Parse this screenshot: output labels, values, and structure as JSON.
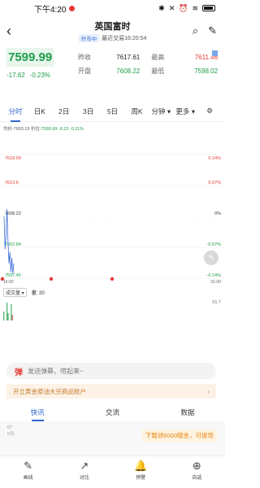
{
  "status": {
    "time": "下午4:20"
  },
  "header": {
    "title": "英国富时",
    "status_badge": "开市中",
    "update_time": "最近交易16:20:54"
  },
  "quote": {
    "price": "7599.99",
    "change": "-17.62",
    "change_pct": "-0.23%",
    "prev_close_label": "昨收",
    "prev_close": "7617.61",
    "high_label": "最高",
    "high": "7611.46",
    "open_label": "开盘",
    "open": "7608.22",
    "low_label": "最低",
    "low": "7598.02"
  },
  "tabs": [
    "分时",
    "日K",
    "2日",
    "3日",
    "5日",
    "周K",
    "分钟",
    "更多"
  ],
  "avg_line": {
    "avg_label": "均价:",
    "avg": "7603.15",
    "price_label": "价位:",
    "price": "7599.99",
    "delta": "-8.23",
    "delta_pct": "-0.11%"
  },
  "chart_data": {
    "type": "line",
    "y_axis_left": [
      "7618.99",
      "7613.6",
      "7608.22",
      "7602.84",
      "7597.45"
    ],
    "y_axis_right": [
      "0.14%",
      "0.07%",
      "0%",
      "-0.07%",
      "-0.14%"
    ],
    "x_labels": [
      "16:00",
      "01:00"
    ],
    "series": [
      {
        "x": [
          0,
          1,
          2,
          3,
          4,
          5,
          6,
          7,
          8,
          9,
          10
        ],
        "values": [
          7608.2,
          7602.5,
          7605,
          7609.5,
          7604,
          7600,
          7602,
          7598.5,
          7601,
          7598.2,
          7599.99
        ]
      }
    ],
    "volume_axis": [
      "51.7",
      "25.85"
    ]
  },
  "volume": {
    "selector": "成交量",
    "label": "量: 20"
  },
  "comment": {
    "icon_text": "弹",
    "placeholder": "发送弹幕，唠起来~"
  },
  "ad": {
    "text": "开立黄金原油大宗商品账户"
  },
  "subtabs": [
    "快讯",
    "交流",
    "数据"
  ],
  "news": {
    "date_line1": "07",
    "date_line2": "6月",
    "promo": "下载领6000赠金，可提现"
  },
  "bottom_nav": [
    "画线",
    "对比",
    "预警",
    "自选"
  ]
}
